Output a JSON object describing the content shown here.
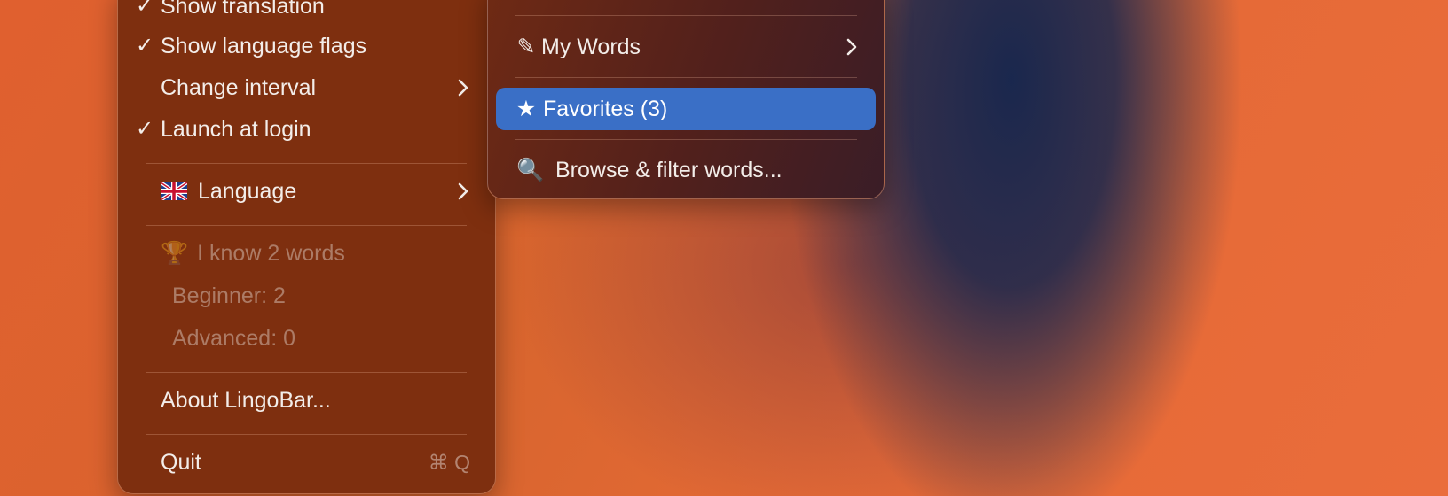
{
  "main_menu": {
    "items": [
      {
        "label": "Show translation",
        "checked": "✓"
      },
      {
        "label": "Show language flags",
        "checked": "✓"
      },
      {
        "label": "Change interval"
      },
      {
        "label": "Launch at login",
        "checked": "✓"
      },
      {
        "label": "Language",
        "flag": "uk-flag"
      },
      {
        "label": "I know 2 words",
        "icon": "🏆"
      },
      {
        "label": "Beginner: 2"
      },
      {
        "label": "Advanced: 0"
      },
      {
        "label": "About LingoBar..."
      },
      {
        "label": "Quit",
        "shortcut": "⌘ Q"
      }
    ]
  },
  "sub_menu": {
    "items": [
      {
        "label": "My Words",
        "icon": "✎"
      },
      {
        "label": "Favorites (3)",
        "icon": "★"
      },
      {
        "label": "Browse & filter words...",
        "icon": "🔍"
      }
    ]
  },
  "colors": {
    "menu_background": "#7e2f0f",
    "highlight": "#3a6fc6"
  }
}
